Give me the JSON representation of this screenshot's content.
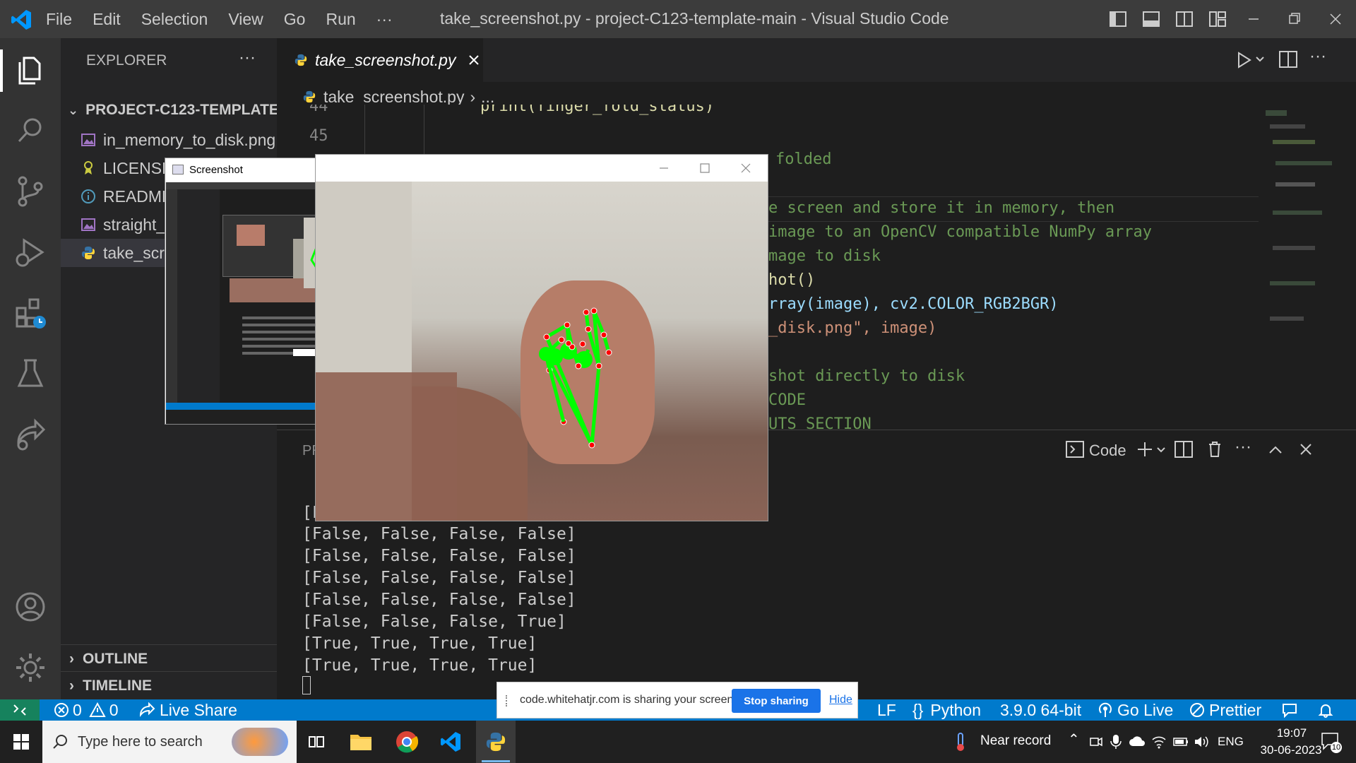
{
  "titlebar": {
    "menu": [
      "File",
      "Edit",
      "Selection",
      "View",
      "Go",
      "Run",
      "···"
    ],
    "title": "take_screenshot.py - project-C123-template-main - Visual Studio Code"
  },
  "sidebar": {
    "header": "EXPLORER",
    "more": "···",
    "project": "PROJECT-C123-TEMPLATE...",
    "files": [
      "in_memory_to_disk.png",
      "LICENSE",
      "README.md",
      "straight_line.py",
      "take_screenshot.py"
    ],
    "outline": "OUTLINE",
    "timeline": "TIMELINE"
  },
  "editor": {
    "tab_label": "take_screenshot.py",
    "breadcrumb_file": "take_screenshot.py",
    "breadcrumb_more": "...",
    "line_numbers": [
      "44",
      "45"
    ],
    "code_lines": [
      "print(finger_fold_status)",
      "",
      "folded",
      "",
      "e screen and store it in memory, then",
      "image to an OpenCV compatible NumPy array",
      "mage to disk",
      "hot()",
      "rray(image), cv2.COLOR_RGB2BGR)",
      "_disk.png\", image)",
      "",
      "shot directly to disk",
      "CODE",
      "UTS SECTION"
    ]
  },
  "panel": {
    "tab_partial": "PR",
    "terminal_profile": "Code",
    "output": [
      "[False, False, False, False]",
      "[False, False, False, False]",
      "[False, False, False, False]",
      "[False, False, False, False]",
      "[False, False, False, True]",
      "[True, True, True, True]",
      "[True, True, True, True]"
    ],
    "partial_first": "[F"
  },
  "statusbar": {
    "errors": "0",
    "warnings": "0",
    "live_share": "Live Share",
    "eol": "LF",
    "language": "Python",
    "interpreter": "3.9.0 64-bit",
    "go_live": "Go Live",
    "prettier": "Prettier"
  },
  "sharebar": {
    "message": "code.whitehatjr.com is sharing your screen.",
    "stop": "Stop sharing",
    "hide": "Hide"
  },
  "screenshot_window": {
    "title": "Screenshot"
  },
  "taskbar": {
    "search_placeholder": "Type here to search",
    "weather": "Near record",
    "language": "ENG",
    "time": "19:07",
    "date": "30-06-2023",
    "notifications": "10"
  },
  "colors": {
    "accent": "#007acc",
    "titlebar": "#3c3c3c",
    "activitybar": "#333333",
    "sidebar": "#252526",
    "editor": "#1e1e1e",
    "code_comment": "#6a9955",
    "landmark_line": "#00ff00",
    "landmark_point": "#ff0000"
  }
}
